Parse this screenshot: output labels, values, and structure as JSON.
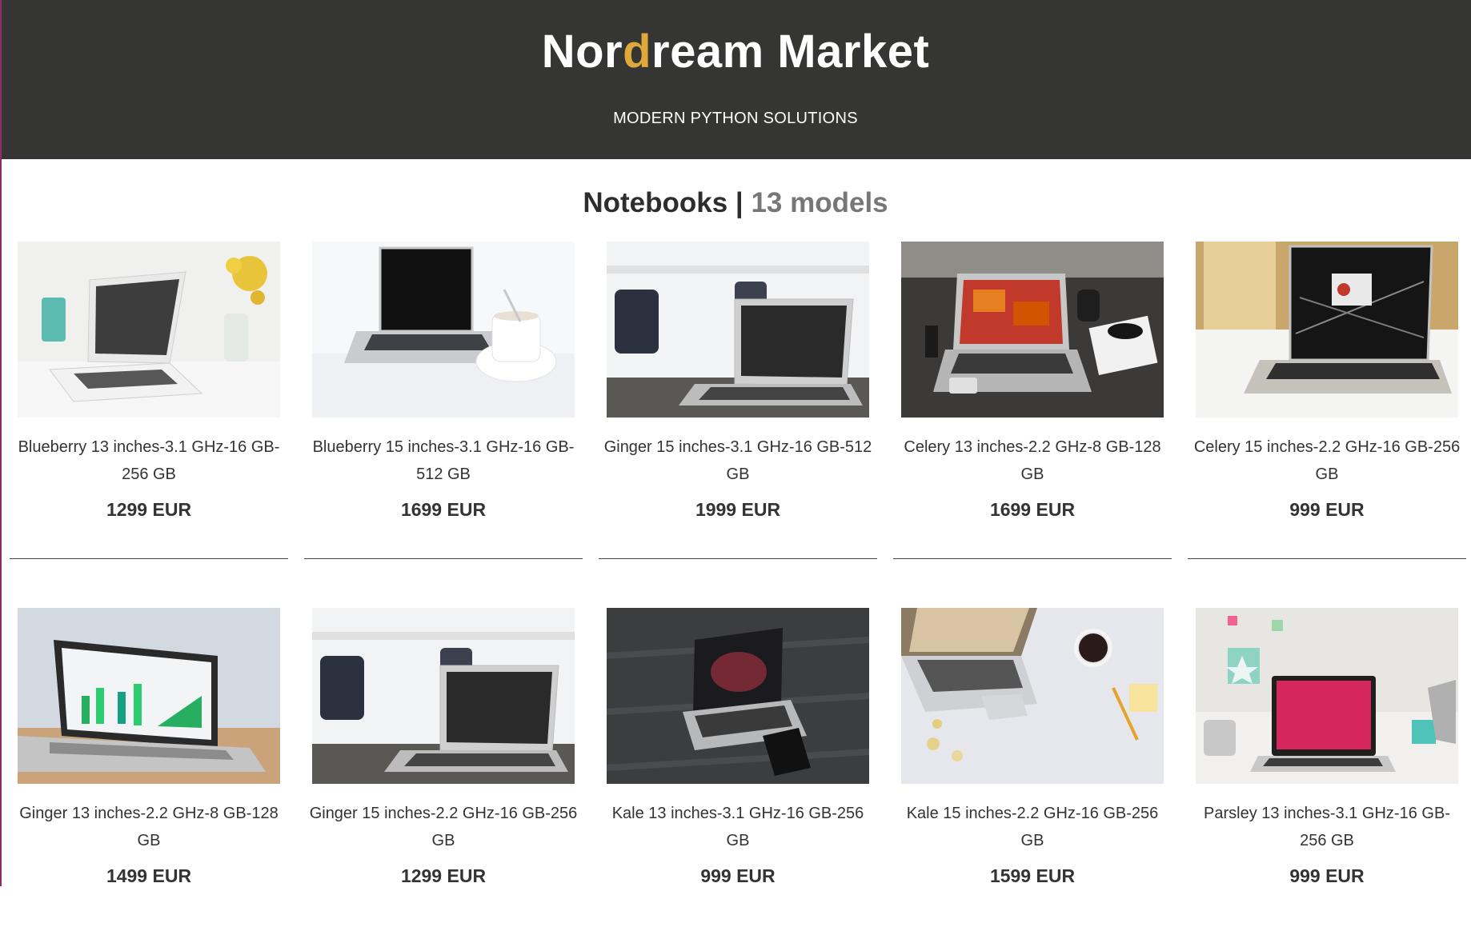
{
  "header": {
    "brand_prefix": "Nor",
    "brand_accent": "d",
    "brand_suffix": "ream Market",
    "tagline": "MODERN PYTHON SOLUTIONS"
  },
  "section": {
    "title": "Notebooks",
    "separator": "|",
    "count": "13 models"
  },
  "products": [
    {
      "name": "Blueberry 13 inches-3.1 GHz-16 GB-256 GB",
      "price": "1299 EUR"
    },
    {
      "name": "Blueberry 15 inches-3.1 GHz-16 GB-512 GB",
      "price": "1699 EUR"
    },
    {
      "name": "Ginger 15 inches-3.1 GHz-16 GB-512 GB",
      "price": "1999 EUR"
    },
    {
      "name": "Celery 13 inches-2.2 GHz-8 GB-128 GB",
      "price": "1699 EUR"
    },
    {
      "name": "Celery 15 inches-2.2 GHz-16 GB-256 GB",
      "price": "999 EUR"
    },
    {
      "name": "Ginger 13 inches-2.2 GHz-8 GB-128 GB",
      "price": "1499 EUR"
    },
    {
      "name": "Ginger 15 inches-2.2 GHz-16 GB-256 GB",
      "price": "1299 EUR"
    },
    {
      "name": "Kale 13 inches-3.1 GHz-16 GB-256 GB",
      "price": "999 EUR"
    },
    {
      "name": "Kale 15 inches-2.2 GHz-16 GB-256 GB",
      "price": "1599 EUR"
    },
    {
      "name": "Parsley 13 inches-3.1 GHz-16 GB-256 GB",
      "price": "999 EUR"
    }
  ],
  "colors": {
    "header_bg": "#353533",
    "brand_accent": "#e0a83a",
    "count_text": "#777777"
  }
}
